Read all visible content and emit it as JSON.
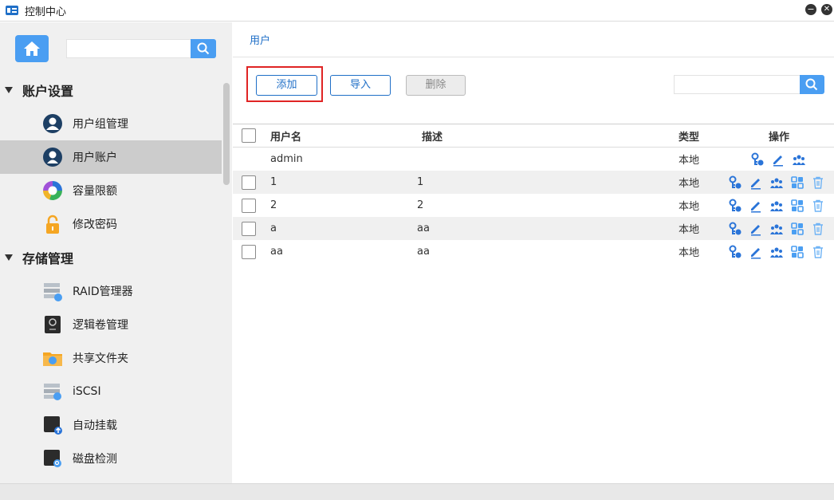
{
  "window": {
    "title": "控制中心"
  },
  "sidebar": {
    "search_placeholder": "",
    "sections": [
      {
        "label": "账户设置"
      },
      {
        "label": "存储管理"
      }
    ],
    "items": [
      {
        "label": "用户组管理",
        "icon": "user-group-icon"
      },
      {
        "label": "用户账户",
        "icon": "user-account-icon",
        "active": true
      },
      {
        "label": "容量限额",
        "icon": "quota-icon"
      },
      {
        "label": "修改密码",
        "icon": "lock-icon"
      },
      {
        "label": "RAID管理器",
        "icon": "raid-icon"
      },
      {
        "label": "逻辑卷管理",
        "icon": "logical-volume-icon"
      },
      {
        "label": "共享文件夹",
        "icon": "shared-folder-icon"
      },
      {
        "label": "iSCSI",
        "icon": "iscsi-icon"
      },
      {
        "label": "自动挂载",
        "icon": "auto-mount-icon"
      },
      {
        "label": "磁盘检测",
        "icon": "disk-check-icon"
      }
    ]
  },
  "main": {
    "breadcrumb": "用户",
    "toolbar": {
      "add_label": "添加",
      "import_label": "导入",
      "delete_label": "删除",
      "search_placeholder": ""
    },
    "table": {
      "columns": {
        "name": "用户名",
        "desc": "描述",
        "type": "类型",
        "ops": "操作"
      },
      "rows": [
        {
          "name": "admin",
          "desc": "",
          "type": "本地",
          "checkbox": false
        },
        {
          "name": "1",
          "desc": "1",
          "type": "本地",
          "checkbox": true
        },
        {
          "name": "2",
          "desc": "2",
          "type": "本地",
          "checkbox": true
        },
        {
          "name": "a",
          "desc": "aa",
          "type": "本地",
          "checkbox": true
        },
        {
          "name": "aa",
          "desc": "aa",
          "type": "本地",
          "checkbox": true
        }
      ]
    }
  },
  "colors": {
    "accent": "#4a9ef2",
    "link": "#1f6fc7",
    "highlight": "#e02424"
  }
}
